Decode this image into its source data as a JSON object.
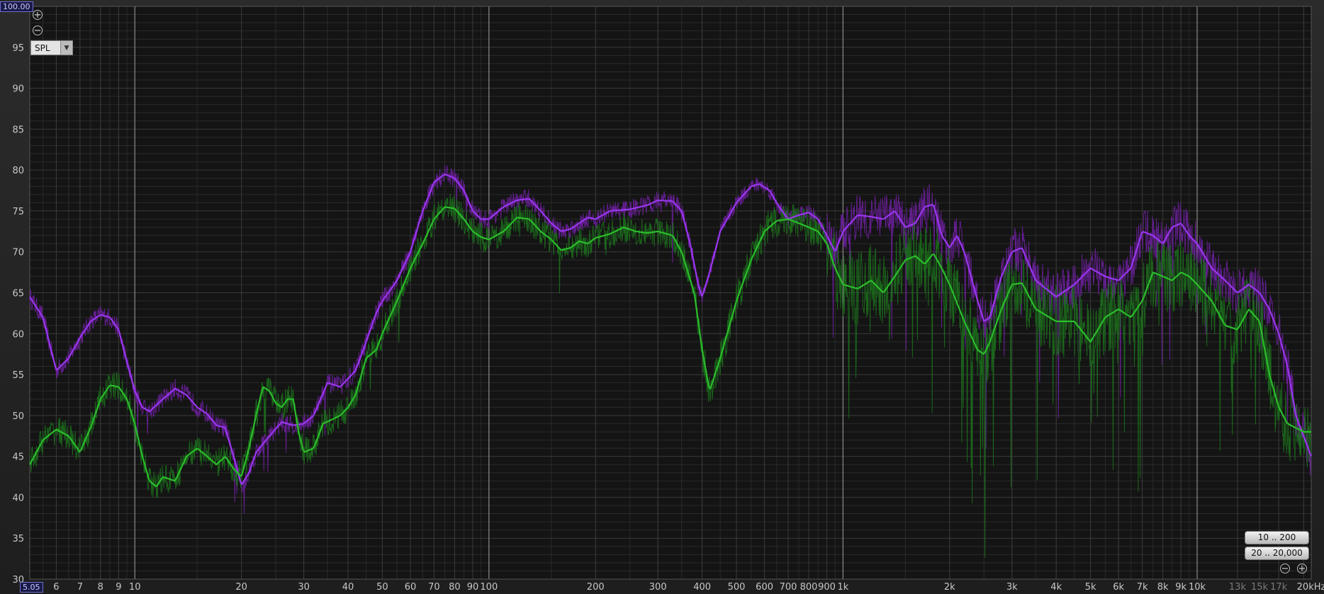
{
  "controls": {
    "y_max_value": "100.00",
    "x_min_value": "5.05",
    "spl_label": "SPL",
    "range_buttons": [
      "10 .. 200",
      "20 .. 20,000"
    ]
  },
  "colors": {
    "background": "#141414",
    "grid_major": "#5c5c5c",
    "grid_minor": "#2a2a2a",
    "trace_purple_smoothed": "#9a36ef",
    "trace_purple_raw": "#6a1f9a",
    "trace_green_smoothed": "#2bbd2b",
    "trace_green_raw": "#1c6e1c"
  },
  "chart_data": {
    "type": "line",
    "x_scale": "log",
    "xlim": [
      5.05,
      21000
    ],
    "ylim": [
      30,
      100
    ],
    "grid": true,
    "y_ticks": [
      "30",
      "35",
      "40",
      "45",
      "50",
      "55",
      "60",
      "65",
      "70",
      "75",
      "80",
      "85",
      "90",
      "95"
    ],
    "x_ticks": [
      {
        "v": 6,
        "label": "6"
      },
      {
        "v": 7,
        "label": "7"
      },
      {
        "v": 8,
        "label": "8"
      },
      {
        "v": 9,
        "label": "9"
      },
      {
        "v": 10,
        "label": "10"
      },
      {
        "v": 20,
        "label": "20"
      },
      {
        "v": 30,
        "label": "30"
      },
      {
        "v": 40,
        "label": "40"
      },
      {
        "v": 50,
        "label": "50"
      },
      {
        "v": 60,
        "label": "60"
      },
      {
        "v": 70,
        "label": "70"
      },
      {
        "v": 80,
        "label": "80"
      },
      {
        "v": 90,
        "label": "90"
      },
      {
        "v": 100,
        "label": "100"
      },
      {
        "v": 200,
        "label": "200"
      },
      {
        "v": 300,
        "label": "300"
      },
      {
        "v": 400,
        "label": "400"
      },
      {
        "v": 500,
        "label": "500"
      },
      {
        "v": 600,
        "label": "600"
      },
      {
        "v": 700,
        "label": "700"
      },
      {
        "v": 800,
        "label": "800"
      },
      {
        "v": 900,
        "label": "900"
      },
      {
        "v": 1000,
        "label": "1k"
      },
      {
        "v": 2000,
        "label": "2k"
      },
      {
        "v": 3000,
        "label": "3k"
      },
      {
        "v": 4000,
        "label": "4k"
      },
      {
        "v": 5000,
        "label": "5k"
      },
      {
        "v": 6000,
        "label": "6k"
      },
      {
        "v": 7000,
        "label": "7k"
      },
      {
        "v": 8000,
        "label": "8k"
      },
      {
        "v": 9000,
        "label": "9k"
      },
      {
        "v": 10000,
        "label": "10k"
      },
      {
        "v": 13000,
        "label": "13k",
        "dim": true
      },
      {
        "v": 15000,
        "label": "15k",
        "dim": true
      },
      {
        "v": 17000,
        "label": "17k",
        "dim": true
      },
      {
        "v": 20000,
        "label": "20kHz"
      }
    ],
    "series": [
      {
        "color": "#9a36ef",
        "points": [
          [
            5.05,
            64.5
          ],
          [
            5.5,
            62
          ],
          [
            6,
            55.5
          ],
          [
            6.5,
            57
          ],
          [
            7,
            59.5
          ],
          [
            7.5,
            61.5
          ],
          [
            8,
            62.3
          ],
          [
            8.5,
            62
          ],
          [
            9,
            60.5
          ],
          [
            9.5,
            56.5
          ],
          [
            10,
            53
          ],
          [
            10.5,
            51
          ],
          [
            11,
            50.5
          ],
          [
            12,
            52
          ],
          [
            13,
            53.3
          ],
          [
            14,
            52.5
          ],
          [
            15,
            51
          ],
          [
            16,
            50.2
          ],
          [
            17,
            48.8
          ],
          [
            18,
            48.5
          ],
          [
            19,
            45
          ],
          [
            20,
            41.5
          ],
          [
            21,
            43
          ],
          [
            22,
            45.5
          ],
          [
            24,
            47.5
          ],
          [
            26,
            49.2
          ],
          [
            28,
            48.8
          ],
          [
            30,
            49
          ],
          [
            32,
            50
          ],
          [
            35,
            54
          ],
          [
            38,
            53.5
          ],
          [
            40,
            54.5
          ],
          [
            42,
            55.5
          ],
          [
            45,
            59
          ],
          [
            48,
            62.5
          ],
          [
            50,
            64
          ],
          [
            55,
            66.5
          ],
          [
            60,
            70
          ],
          [
            65,
            75
          ],
          [
            70,
            78.5
          ],
          [
            75,
            79.5
          ],
          [
            80,
            79
          ],
          [
            85,
            77.5
          ],
          [
            90,
            75
          ],
          [
            95,
            74
          ],
          [
            100,
            74
          ],
          [
            110,
            75.5
          ],
          [
            120,
            76.3
          ],
          [
            130,
            76.5
          ],
          [
            140,
            75
          ],
          [
            150,
            73.5
          ],
          [
            160,
            72.5
          ],
          [
            170,
            72.8
          ],
          [
            180,
            73.5
          ],
          [
            190,
            74.2
          ],
          [
            200,
            74
          ],
          [
            220,
            75
          ],
          [
            250,
            75.2
          ],
          [
            280,
            75.7
          ],
          [
            300,
            76.3
          ],
          [
            330,
            76.2
          ],
          [
            350,
            75
          ],
          [
            370,
            71
          ],
          [
            390,
            66
          ],
          [
            400,
            64.5
          ],
          [
            420,
            67.5
          ],
          [
            450,
            72.5
          ],
          [
            500,
            76
          ],
          [
            550,
            78
          ],
          [
            580,
            78.3
          ],
          [
            620,
            77.5
          ],
          [
            660,
            75.5
          ],
          [
            700,
            74
          ],
          [
            750,
            74.5
          ],
          [
            800,
            74.8
          ],
          [
            850,
            74
          ],
          [
            900,
            72
          ],
          [
            950,
            70
          ],
          [
            1000,
            72.5
          ],
          [
            1100,
            74.5
          ],
          [
            1200,
            74.3
          ],
          [
            1300,
            74
          ],
          [
            1400,
            75
          ],
          [
            1500,
            73
          ],
          [
            1600,
            73.5
          ],
          [
            1700,
            75.5
          ],
          [
            1800,
            75.8
          ],
          [
            1900,
            72
          ],
          [
            2000,
            70.5
          ],
          [
            2100,
            72
          ],
          [
            2200,
            70
          ],
          [
            2400,
            64
          ],
          [
            2500,
            61.5
          ],
          [
            2600,
            62
          ],
          [
            2800,
            67
          ],
          [
            3000,
            70
          ],
          [
            3200,
            70.5
          ],
          [
            3500,
            66.5
          ],
          [
            4000,
            64.5
          ],
          [
            4500,
            66
          ],
          [
            5000,
            68
          ],
          [
            5500,
            67
          ],
          [
            6000,
            66.5
          ],
          [
            6500,
            68
          ],
          [
            7000,
            72.5
          ],
          [
            7500,
            72
          ],
          [
            8000,
            71
          ],
          [
            8500,
            73
          ],
          [
            9000,
            73.5
          ],
          [
            9500,
            72
          ],
          [
            10000,
            71
          ],
          [
            11000,
            68
          ],
          [
            12000,
            66.5
          ],
          [
            13000,
            65
          ],
          [
            14000,
            66
          ],
          [
            15000,
            65
          ],
          [
            16000,
            63
          ],
          [
            17000,
            60
          ],
          [
            18000,
            56
          ],
          [
            19000,
            50
          ],
          [
            21000,
            45
          ]
        ]
      },
      {
        "color": "#2bbd2b",
        "points": [
          [
            5.05,
            44
          ],
          [
            5.5,
            47
          ],
          [
            6,
            48.3
          ],
          [
            6.5,
            47.5
          ],
          [
            7,
            45.5
          ],
          [
            7.5,
            48.5
          ],
          [
            8,
            52
          ],
          [
            8.5,
            53.7
          ],
          [
            9,
            53.5
          ],
          [
            9.5,
            52
          ],
          [
            10,
            49
          ],
          [
            10.5,
            45
          ],
          [
            11,
            42
          ],
          [
            11.5,
            41.3
          ],
          [
            12,
            42.5
          ],
          [
            13,
            42
          ],
          [
            14,
            45
          ],
          [
            15,
            46
          ],
          [
            16,
            45
          ],
          [
            17,
            44
          ],
          [
            18,
            45
          ],
          [
            19,
            43.5
          ],
          [
            20,
            42.5
          ],
          [
            21,
            46
          ],
          [
            22,
            50
          ],
          [
            23,
            53.5
          ],
          [
            24,
            53
          ],
          [
            25,
            51.5
          ],
          [
            26,
            51
          ],
          [
            27,
            52
          ],
          [
            28,
            52
          ],
          [
            29,
            48
          ],
          [
            30,
            45.5
          ],
          [
            32,
            46
          ],
          [
            34,
            49
          ],
          [
            36,
            49.5
          ],
          [
            38,
            50
          ],
          [
            40,
            51
          ],
          [
            42,
            52.5
          ],
          [
            45,
            57
          ],
          [
            48,
            58
          ],
          [
            50,
            60
          ],
          [
            55,
            64
          ],
          [
            60,
            68
          ],
          [
            65,
            71
          ],
          [
            70,
            74
          ],
          [
            75,
            75.5
          ],
          [
            80,
            75.3
          ],
          [
            85,
            74
          ],
          [
            90,
            72.5
          ],
          [
            95,
            71.8
          ],
          [
            100,
            71.5
          ],
          [
            110,
            72.5
          ],
          [
            120,
            74.2
          ],
          [
            130,
            74
          ],
          [
            140,
            72.5
          ],
          [
            150,
            71.5
          ],
          [
            160,
            70.2
          ],
          [
            170,
            70.5
          ],
          [
            180,
            71.3
          ],
          [
            190,
            71
          ],
          [
            200,
            71.7
          ],
          [
            220,
            72.2
          ],
          [
            240,
            73
          ],
          [
            260,
            72.5
          ],
          [
            280,
            72.3
          ],
          [
            300,
            72.5
          ],
          [
            330,
            72
          ],
          [
            350,
            70
          ],
          [
            380,
            65
          ],
          [
            400,
            58
          ],
          [
            420,
            53
          ],
          [
            450,
            57
          ],
          [
            500,
            64
          ],
          [
            550,
            69
          ],
          [
            600,
            72.5
          ],
          [
            650,
            73.8
          ],
          [
            700,
            74
          ],
          [
            750,
            73.5
          ],
          [
            800,
            73
          ],
          [
            850,
            72.5
          ],
          [
            900,
            71
          ],
          [
            950,
            68
          ],
          [
            1000,
            66
          ],
          [
            1100,
            65.5
          ],
          [
            1200,
            66.5
          ],
          [
            1300,
            65
          ],
          [
            1400,
            67
          ],
          [
            1500,
            69
          ],
          [
            1600,
            69.5
          ],
          [
            1700,
            68.5
          ],
          [
            1800,
            69.8
          ],
          [
            1900,
            68
          ],
          [
            2000,
            66
          ],
          [
            2200,
            61.5
          ],
          [
            2400,
            58
          ],
          [
            2500,
            57.5
          ],
          [
            2600,
            59
          ],
          [
            2800,
            63
          ],
          [
            3000,
            66
          ],
          [
            3200,
            66.2
          ],
          [
            3500,
            63
          ],
          [
            4000,
            61.5
          ],
          [
            4500,
            61.5
          ],
          [
            5000,
            59
          ],
          [
            5500,
            62
          ],
          [
            6000,
            63
          ],
          [
            6500,
            62
          ],
          [
            7000,
            64
          ],
          [
            7500,
            67.5
          ],
          [
            8000,
            67
          ],
          [
            8500,
            66.5
          ],
          [
            9000,
            67.5
          ],
          [
            9500,
            67
          ],
          [
            10000,
            66
          ],
          [
            11000,
            64
          ],
          [
            12000,
            61
          ],
          [
            13000,
            60.5
          ],
          [
            14000,
            63
          ],
          [
            15000,
            61.5
          ],
          [
            16000,
            55
          ],
          [
            17000,
            51
          ],
          [
            18000,
            49
          ],
          [
            20000,
            48
          ]
        ]
      }
    ]
  }
}
